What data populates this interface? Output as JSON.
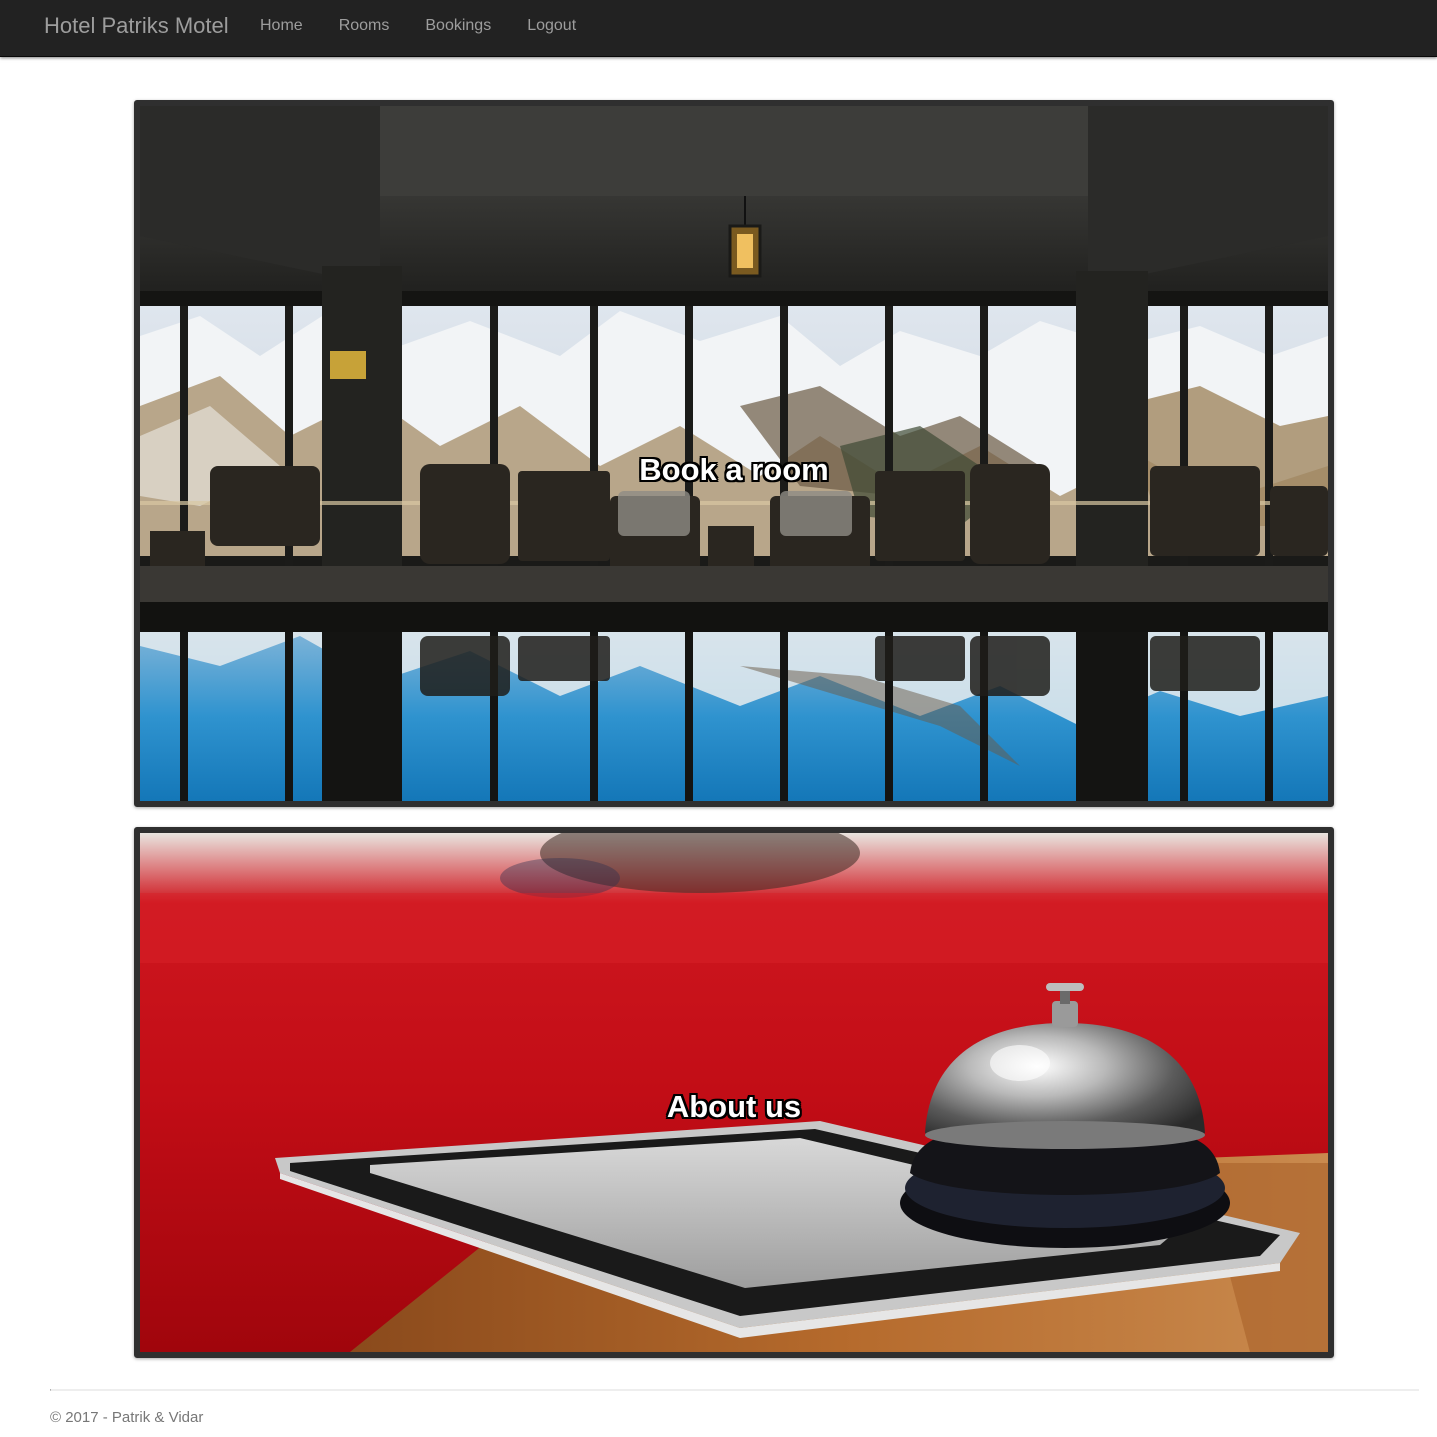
{
  "navbar": {
    "brand": "Hotel Patriks Motel",
    "links": [
      {
        "label": "Home"
      },
      {
        "label": "Rooms"
      },
      {
        "label": "Bookings"
      },
      {
        "label": "Logout"
      }
    ]
  },
  "panels": {
    "book": {
      "title": "Book a room"
    },
    "about": {
      "title": "About us"
    }
  },
  "footer": {
    "text": "© 2017 - Patrik & Vidar"
  },
  "colors": {
    "navbar_bg": "#222222",
    "nav_text": "#9d9d9d",
    "panel_border": "#2f2f2f",
    "footer_text": "#777777"
  }
}
